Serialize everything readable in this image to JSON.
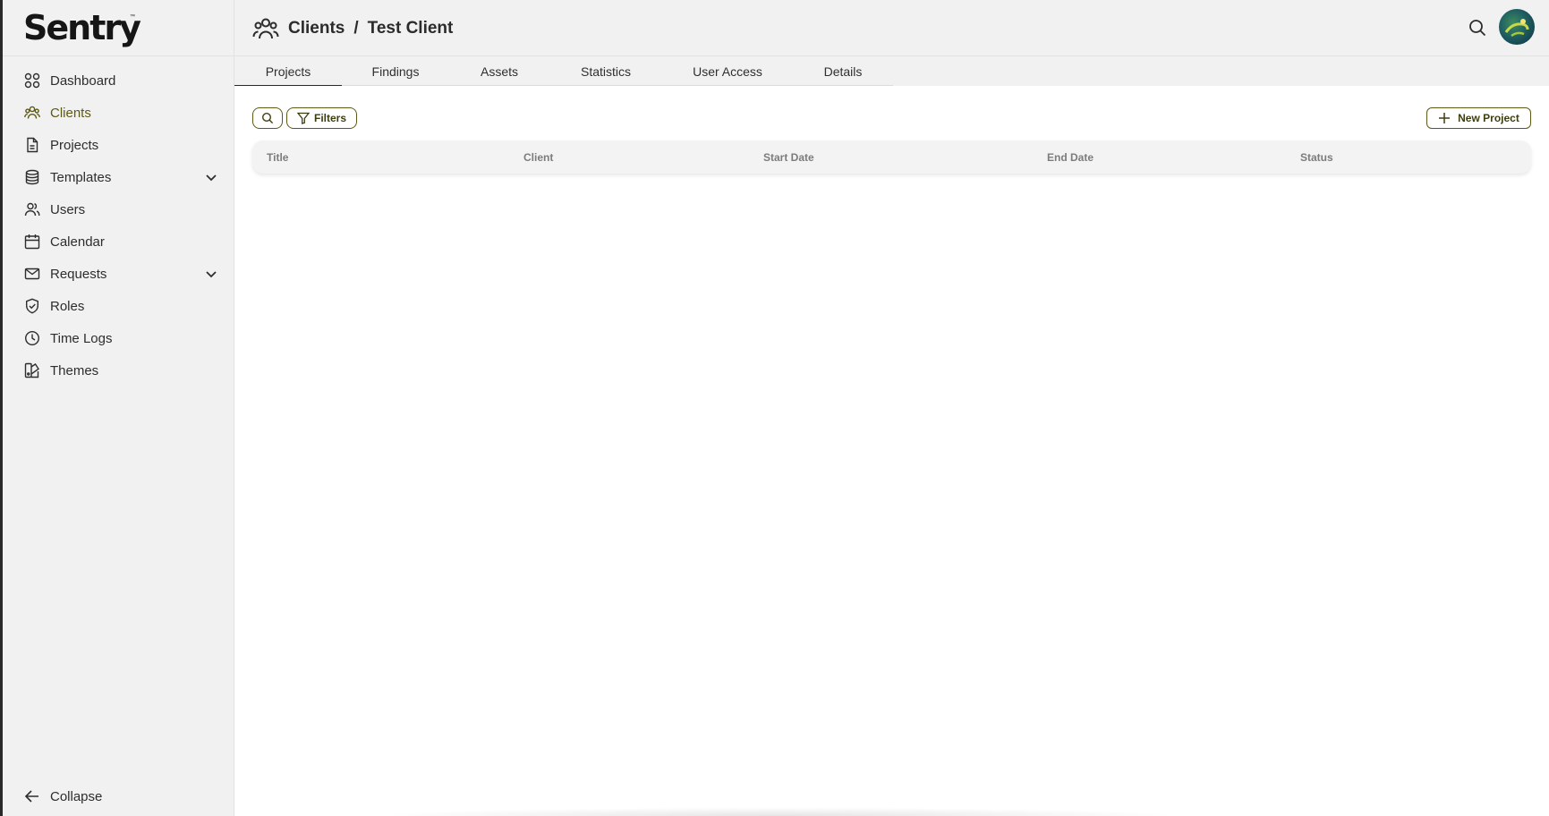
{
  "app": {
    "logo_text": "Sentry",
    "logo_tm": "™"
  },
  "sidebar": {
    "items": [
      {
        "label": "Dashboard",
        "icon": "dashboard-icon"
      },
      {
        "label": "Clients",
        "icon": "clients-icon",
        "active": true
      },
      {
        "label": "Projects",
        "icon": "document-icon"
      },
      {
        "label": "Templates",
        "icon": "database-icon",
        "expandable": true
      },
      {
        "label": "Users",
        "icon": "users-icon"
      },
      {
        "label": "Calendar",
        "icon": "calendar-icon"
      },
      {
        "label": "Requests",
        "icon": "mail-icon",
        "expandable": true
      },
      {
        "label": "Roles",
        "icon": "shield-check-icon"
      },
      {
        "label": "Time Logs",
        "icon": "clock-icon"
      },
      {
        "label": "Themes",
        "icon": "palette-icon"
      }
    ],
    "collapse_label": "Collapse"
  },
  "header": {
    "breadcrumb": {
      "section": "Clients",
      "separator": "/",
      "current": "Test Client"
    }
  },
  "tabs": [
    {
      "label": "Projects",
      "active": true
    },
    {
      "label": "Findings"
    },
    {
      "label": "Assets"
    },
    {
      "label": "Statistics"
    },
    {
      "label": "User Access"
    },
    {
      "label": "Details"
    }
  ],
  "toolbar": {
    "filters_label": "Filters",
    "new_project_label": "New Project"
  },
  "table": {
    "columns": [
      "Title",
      "Client",
      "Start Date",
      "End Date",
      "Status"
    ],
    "rows": []
  },
  "colors": {
    "accent": "#5c5a14",
    "sidebar_bg": "#f1f1f1",
    "active_nav": "#5c5a14"
  }
}
